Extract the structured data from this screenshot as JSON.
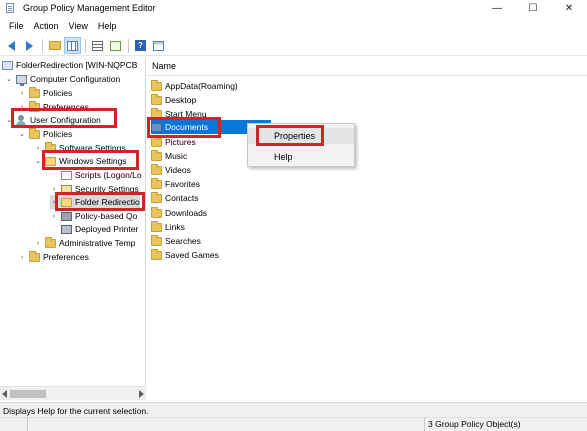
{
  "window": {
    "title": "Group Policy Management Editor",
    "minimize_glyph": "—",
    "maximize_glyph": "☐",
    "close_glyph": "✕"
  },
  "menu": [
    "File",
    "Action",
    "View",
    "Help"
  ],
  "toolbar": {
    "icons": [
      "back-icon",
      "forward-icon",
      "up-folder-icon",
      "show-hide-tree-icon",
      "properties-icon",
      "export-list-icon",
      "help-icon",
      "view-icon"
    ],
    "help_glyph": "?"
  },
  "tree": {
    "items": [
      {
        "label": "FolderRedirection [WIN-NQPCB",
        "toggle": "",
        "icon": "gpo"
      },
      {
        "label": "Computer Configuration",
        "toggle": "⌄",
        "icon": "computer"
      },
      {
        "label": "Policies",
        "toggle": "›",
        "icon": "folder"
      },
      {
        "label": "Preferences",
        "toggle": "›",
        "icon": "folder"
      },
      {
        "label": "User Configuration",
        "toggle": "⌄",
        "icon": "user"
      },
      {
        "label": "Policies",
        "toggle": "⌄",
        "icon": "folder"
      },
      {
        "label": "Software Settings",
        "toggle": "›",
        "icon": "folder"
      },
      {
        "label": "Windows Settings",
        "toggle": "⌄",
        "icon": "folder-open"
      },
      {
        "label": "Scripts (Logon/Lo",
        "toggle": "",
        "icon": "script"
      },
      {
        "label": "Security Settings",
        "toggle": "›",
        "icon": "security"
      },
      {
        "label": "Folder Redirectio",
        "toggle": "›",
        "icon": "folder-open"
      },
      {
        "label": "Policy-based Qo",
        "toggle": "›",
        "icon": "policy"
      },
      {
        "label": "Deployed Printer",
        "toggle": "",
        "icon": "printer"
      },
      {
        "label": "Administrative Temp",
        "toggle": "›",
        "icon": "folder"
      },
      {
        "label": "Preferences",
        "toggle": "›",
        "icon": "folder"
      }
    ]
  },
  "content": {
    "column_header": "Name",
    "items": [
      {
        "label": "AppData(Roaming)",
        "icon": "folder"
      },
      {
        "label": "Desktop",
        "icon": "folder"
      },
      {
        "label": "Start Menu",
        "icon": "folder"
      },
      {
        "label": "Documents",
        "icon": "doc"
      },
      {
        "label": "Pictures",
        "icon": "folder"
      },
      {
        "label": "Music",
        "icon": "folder"
      },
      {
        "label": "Videos",
        "icon": "folder"
      },
      {
        "label": "Favorites",
        "icon": "folder"
      },
      {
        "label": "Contacts",
        "icon": "folder"
      },
      {
        "label": "Downloads",
        "icon": "folder"
      },
      {
        "label": "Links",
        "icon": "folder"
      },
      {
        "label": "Searches",
        "icon": "folder"
      },
      {
        "label": "Saved Games",
        "icon": "folder"
      }
    ]
  },
  "context_menu": {
    "items": [
      "Properties",
      "Help"
    ]
  },
  "status": {
    "text": "Displays Help for the current selection.",
    "right": "3 Group Policy Object(s)"
  },
  "colors": {
    "annotation": "#d2232a",
    "selection": "#0a77d8"
  }
}
